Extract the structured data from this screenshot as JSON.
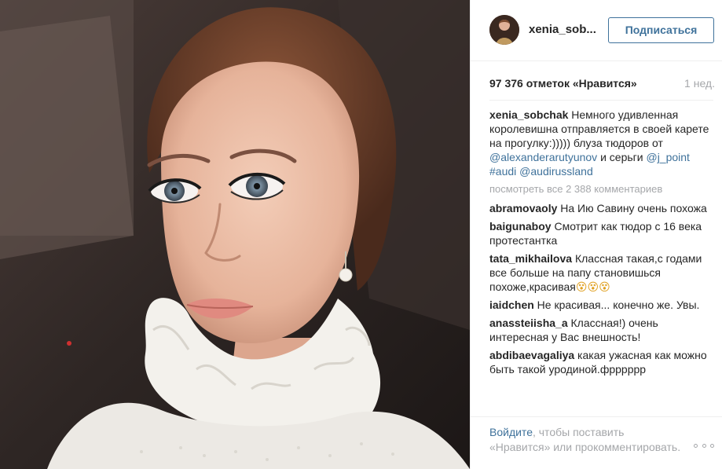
{
  "photo": {
    "icon": "portrait-photo"
  },
  "header": {
    "username": "xenia_sob...",
    "follow_label": "Подписаться"
  },
  "stats": {
    "likes": "97 376 отметок «Нравится»",
    "time": "1 нед."
  },
  "caption": {
    "user": "xenia_sobchak",
    "text_1": " Немного удивленная королевишна отправляется в своей карете на прогулку:))))) блуза тюдоров от ",
    "link_1": "@alexanderarutyunov",
    "text_2": " и серьги ",
    "link_2": "@j_point",
    "text_3": " ",
    "link_3": "#audi",
    "text_4": " ",
    "link_4": "@audirussland"
  },
  "view_all": "посмотреть все 2 388 комментариев",
  "comments": [
    {
      "user": "abramovaoly",
      "text": " На Ию Савину очень похожа"
    },
    {
      "user": "baigunaboy",
      "text": " Смотрит как тюдор с 16 века протестантка"
    },
    {
      "user": "tata_mikhailova",
      "text": " Классная такая,с годами все больше на папу становишься похоже,красивая",
      "emoji": "😵😵😵"
    },
    {
      "user": "iaidchen",
      "text": " Не красивая... конечно же. Увы."
    },
    {
      "user": "anassteiisha_a",
      "text": " Классная!) очень интересная у Вас внешность!"
    },
    {
      "user": "abdibaevagaliya",
      "text": " какая ужасная как можно быть такой уродиной.фрррррр"
    }
  ],
  "footer": {
    "login_link": "Войдите",
    "login_text": ", чтобы поставить «Нравится» или прокомментировать.",
    "more_icon": "more-options-icon"
  }
}
